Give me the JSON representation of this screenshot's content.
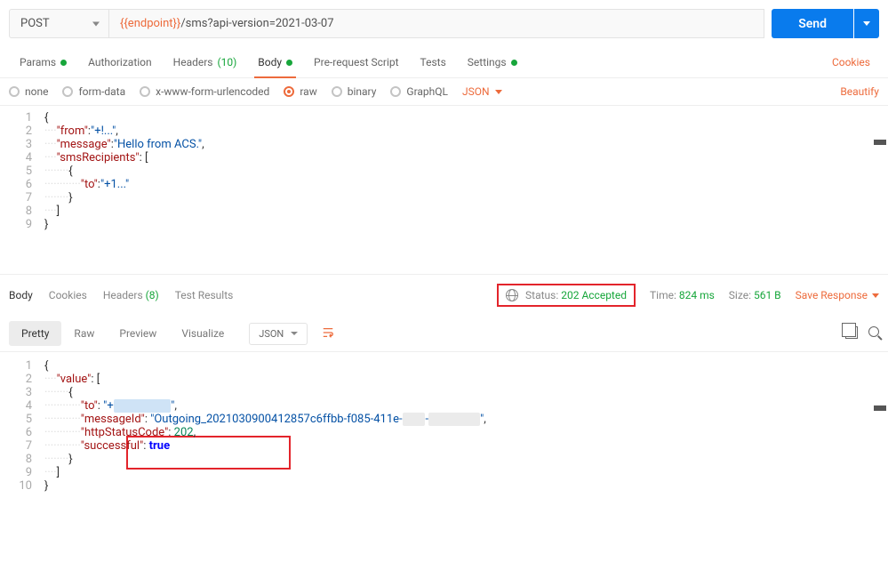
{
  "method": "POST",
  "url_var": "{{endpoint}}",
  "url_path": "/sms?api-version=2021-03-07",
  "send_label": "Send",
  "tabs": {
    "params": "Params",
    "auth": "Authorization",
    "headers": "Headers",
    "headers_count": "(10)",
    "body": "Body",
    "prereq": "Pre-request Script",
    "tests": "Tests",
    "settings": "Settings"
  },
  "cookies_link": "Cookies",
  "body_types": {
    "none": "none",
    "formdata": "form-data",
    "xwww": "x-www-form-urlencoded",
    "raw": "raw",
    "binary": "binary",
    "graphql": "GraphQL",
    "json": "JSON"
  },
  "beautify": "Beautify",
  "request_body_lines": [
    {
      "n": 1,
      "indent": 0,
      "t": [
        [
          "brace",
          "{"
        ]
      ]
    },
    {
      "n": 2,
      "indent": 1,
      "t": [
        [
          "key",
          "\"from\""
        ],
        [
          "brace",
          ":"
        ],
        [
          "str",
          "\"+!...\""
        ],
        [
          "brace",
          ","
        ]
      ]
    },
    {
      "n": 3,
      "indent": 1,
      "t": [
        [
          "key",
          "\"message\""
        ],
        [
          "brace",
          ":"
        ],
        [
          "str",
          "\"Hello from ACS.\""
        ],
        [
          "brace",
          ","
        ]
      ]
    },
    {
      "n": 4,
      "indent": 1,
      "t": [
        [
          "key",
          "\"smsRecipients\""
        ],
        [
          "brace",
          ": ["
        ]
      ]
    },
    {
      "n": 5,
      "indent": 2,
      "t": [
        [
          "brace",
          "{"
        ]
      ]
    },
    {
      "n": 6,
      "indent": 3,
      "t": [
        [
          "key",
          "\"to\""
        ],
        [
          "brace",
          ":"
        ],
        [
          "str",
          "\"+1...\""
        ]
      ]
    },
    {
      "n": 7,
      "indent": 2,
      "t": [
        [
          "brace",
          "}"
        ]
      ]
    },
    {
      "n": 8,
      "indent": 1,
      "t": [
        [
          "brace",
          "]"
        ]
      ]
    },
    {
      "n": 9,
      "indent": 0,
      "t": [
        [
          "brace",
          "}"
        ]
      ]
    }
  ],
  "resp_tabs": {
    "body": "Body",
    "cookies": "Cookies",
    "headers": "Headers",
    "headers_count": "(8)",
    "tests": "Test Results"
  },
  "status_label": "Status:",
  "status_value": "202 Accepted",
  "time_label": "Time:",
  "time_value": "824 ms",
  "size_label": "Size:",
  "size_value": "561 B",
  "save_response": "Save Response",
  "view_tabs": {
    "pretty": "Pretty",
    "raw": "Raw",
    "preview": "Preview",
    "visualize": "Visualize"
  },
  "format_sel": "JSON",
  "response_body_lines": [
    {
      "n": 1,
      "indent": 0,
      "t": [
        [
          "brace",
          "{"
        ]
      ]
    },
    {
      "n": 2,
      "indent": 1,
      "t": [
        [
          "key",
          "\"value\""
        ],
        [
          "brace",
          ": ["
        ]
      ]
    },
    {
      "n": 3,
      "indent": 2,
      "t": [
        [
          "brace",
          "{"
        ]
      ]
    },
    {
      "n": 4,
      "indent": 3,
      "t": [
        [
          "key",
          "\"to\""
        ],
        [
          "brace",
          ": "
        ],
        [
          "str",
          "\"+"
        ],
        [
          "blur",
          "xxxxxxxxxx"
        ],
        [
          "str",
          "\""
        ],
        [
          "brace",
          ","
        ]
      ]
    },
    {
      "n": 5,
      "indent": 3,
      "t": [
        [
          "key",
          "\"messageId\""
        ],
        [
          "brace",
          ": "
        ],
        [
          "str",
          "\"Outgoing_2021030900412857c6ffbb-f085-411e-"
        ],
        [
          "blurg",
          "xxxx"
        ],
        [
          "str",
          "-"
        ],
        [
          "blurg",
          "xxxxxxxxx"
        ],
        [
          "str",
          "\""
        ],
        [
          "brace",
          ","
        ]
      ]
    },
    {
      "n": 6,
      "indent": 3,
      "t": [
        [
          "key",
          "\"httpStatusCode\""
        ],
        [
          "brace",
          ": "
        ],
        [
          "num",
          "202"
        ],
        [
          "brace",
          ","
        ]
      ]
    },
    {
      "n": 7,
      "indent": 3,
      "t": [
        [
          "key",
          "\"successful\""
        ],
        [
          "brace",
          ": "
        ],
        [
          "bool",
          "true"
        ]
      ]
    },
    {
      "n": 8,
      "indent": 2,
      "t": [
        [
          "brace",
          "}"
        ]
      ]
    },
    {
      "n": 9,
      "indent": 1,
      "t": [
        [
          "brace",
          "]"
        ]
      ]
    },
    {
      "n": 10,
      "indent": 0,
      "t": [
        [
          "brace",
          "}"
        ]
      ]
    }
  ]
}
